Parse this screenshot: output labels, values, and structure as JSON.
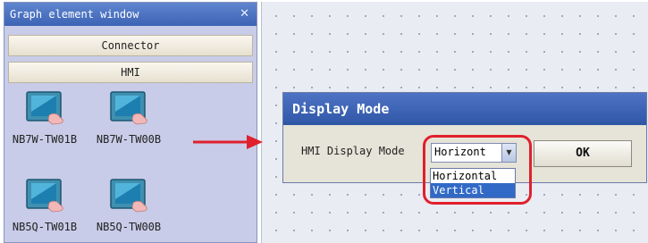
{
  "panel": {
    "title": "Graph element window",
    "close_glyph": "✕",
    "categories": [
      "Connector",
      "HMI"
    ],
    "devices": [
      {
        "label": "NB7W-TW01B",
        "icon": "hmi-touch-panel-icon"
      },
      {
        "label": "NB7W-TW00B",
        "icon": "hmi-touch-panel-icon"
      },
      {
        "label": "NB5Q-TW01B",
        "icon": "hmi-touch-panel-icon"
      },
      {
        "label": "NB5Q-TW00B",
        "icon": "hmi-touch-panel-icon"
      }
    ]
  },
  "dialog": {
    "title": "Display Mode",
    "field_label": "HMI Display Mode",
    "selected_value": "Horizont",
    "dropdown_glyph": "▼",
    "options": [
      "Horizontal",
      "Vertical"
    ],
    "highlighted_option": "Vertical",
    "ok_label": "OK"
  },
  "colors": {
    "annotation_red": "#e0202c",
    "title_blue": "#3d63b5",
    "selection_blue": "#3169c6",
    "panel_bg": "#c8cce8"
  }
}
